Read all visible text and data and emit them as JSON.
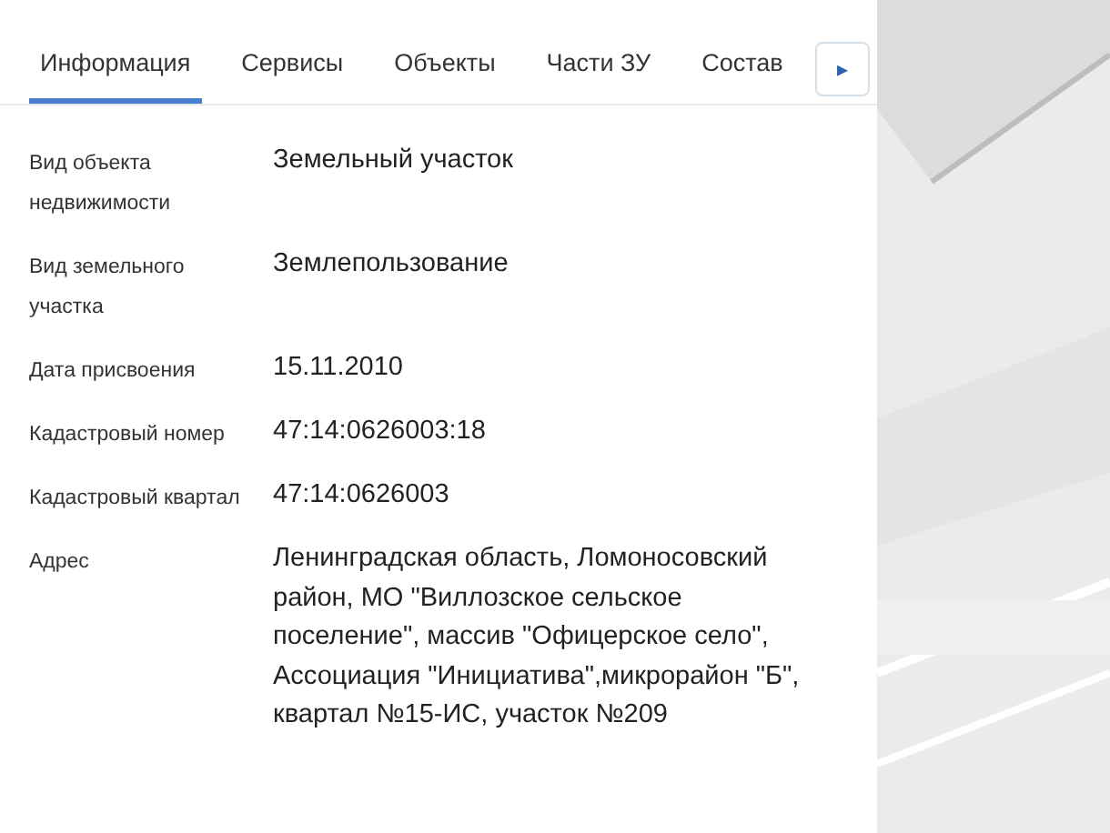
{
  "tabs": [
    {
      "label": "Информация",
      "selected": true
    },
    {
      "label": "Сервисы",
      "selected": false
    },
    {
      "label": "Объекты",
      "selected": false
    },
    {
      "label": "Части ЗУ",
      "selected": false
    },
    {
      "label": "Состав",
      "selected": false
    }
  ],
  "tabs_scroll": {
    "label": "▸"
  },
  "fields": [
    {
      "label": "Вид объекта недвижимости",
      "value": "Земельный участок"
    },
    {
      "label": "Вид земельного участка",
      "value": "Землепользование"
    },
    {
      "label": "Дата присвоения",
      "value": "15.11.2010"
    },
    {
      "label": "Кадастровый номер",
      "value": "47:14:0626003:18"
    },
    {
      "label": "Кадастровый квартал",
      "value": "47:14:0626003"
    },
    {
      "label": "Адрес",
      "value": "Ленинградская область, Ломоносовский район, МО \"Виллозское сельское поселение\", массив \"Офицерское село\", Ассоциация \"Инициатива\",микрорайон \"Б\", квартал №15-ИС, участок №209"
    }
  ]
}
